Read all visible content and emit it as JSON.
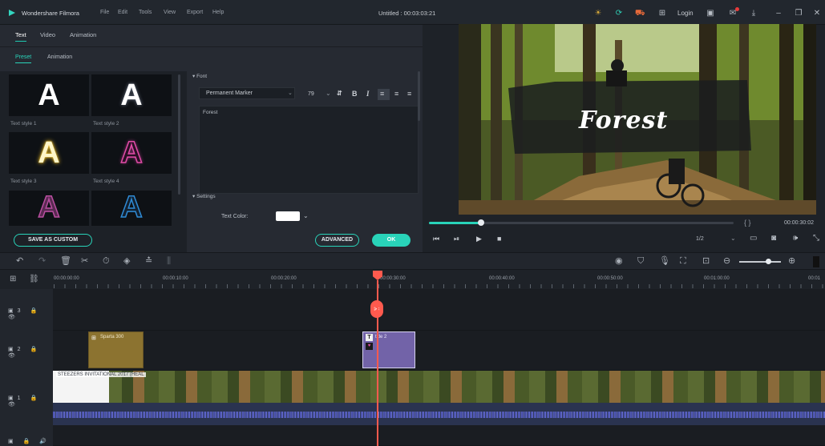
{
  "app": {
    "name": "Wondershare Filmora",
    "document": "Untitled : 00:03:03:21"
  },
  "menu": [
    "File",
    "Edit",
    "Tools",
    "View",
    "Export",
    "Help"
  ],
  "titlebar_icons": [
    "bulb-icon",
    "refresh-icon",
    "cart-icon",
    "gift-icon",
    "login-label",
    "save-icon",
    "notification-icon",
    "download-icon",
    "minimize-icon",
    "maximize-icon",
    "close-icon"
  ],
  "login_label": "Login",
  "top_tabs": [
    "Text",
    "Video",
    "Animation"
  ],
  "sub_tabs": [
    "Preset",
    "Animation"
  ],
  "text_styles": [
    {
      "label": "Text style 1",
      "glyph": "A",
      "color": "#ffffff"
    },
    {
      "label": "Text style 2",
      "glyph": "A",
      "color": "#ffffff"
    },
    {
      "label": "Text style 3",
      "glyph": "A",
      "color": "#fff6c8"
    },
    {
      "label": "Text style 4",
      "glyph": "A",
      "color": "#2a0f24"
    },
    {
      "label": "",
      "glyph": "A",
      "color": "#5a2a52"
    },
    {
      "label": "",
      "glyph": "A",
      "color": "#12202f"
    }
  ],
  "font_section": {
    "title": "Font",
    "font_name": "Permanent Marker",
    "font_size": "79",
    "text_value": "Forest"
  },
  "settings_section": {
    "title": "Settings",
    "text_color_label": "Text Color:"
  },
  "buttons": {
    "save_as_custom": "SAVE AS CUSTOM",
    "advanced": "ADVANCED",
    "ok": "OK"
  },
  "preview": {
    "overlay_text": "Forest",
    "timecode": "00:00:30:02",
    "zoom_ratio": "1/2",
    "progress_fraction": 0.17,
    "brackets": "{   }"
  },
  "ruler": {
    "ticks": [
      "00:00:00:00",
      "00:00:10:00",
      "00:00:20:00",
      "00:00:30:00",
      "00:00:40:00",
      "00:00:50:00",
      "00:01:00:00",
      "00:01"
    ]
  },
  "tracks": [
    {
      "name": "track-3",
      "label": "3"
    },
    {
      "name": "track-2",
      "label": "2",
      "clips": [
        {
          "title": "Sparta 300",
          "kind": "video"
        },
        {
          "title": "title 2",
          "kind": "title"
        }
      ]
    },
    {
      "name": "track-1",
      "label": "1",
      "clips": [
        {
          "title": "STEEZERS INVITATIONAL 2017 (HEAL",
          "kind": "video"
        }
      ]
    }
  ],
  "colors": {
    "accent": "#29d3b9",
    "playhead": "#ff5a4e",
    "title_clip": "#7263a8",
    "sparta_clip": "#8c7330",
    "audio_wave": "#5b63c7"
  }
}
